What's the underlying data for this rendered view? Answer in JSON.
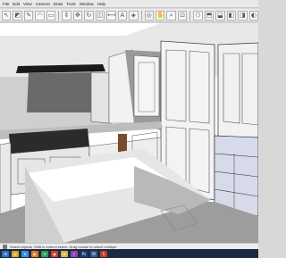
{
  "menubar": {
    "items": [
      "File",
      "Edit",
      "View",
      "Camera",
      "Draw",
      "Tools",
      "Window",
      "Help"
    ]
  },
  "toolbar": {
    "tools": [
      {
        "icon": "select-arrow-icon",
        "glyph": "↖"
      },
      {
        "icon": "eraser-icon",
        "glyph": "◩"
      },
      {
        "icon": "pencil-icon",
        "glyph": "✎"
      },
      {
        "icon": "arc-icon",
        "glyph": "◠"
      },
      {
        "icon": "rectangle-icon",
        "glyph": "▭"
      },
      {
        "icon": "push-pull-icon",
        "glyph": "⇕"
      },
      {
        "icon": "move-icon",
        "glyph": "✥"
      },
      {
        "icon": "rotate-icon",
        "glyph": "↻"
      },
      {
        "icon": "offset-icon",
        "glyph": "◫"
      },
      {
        "icon": "tape-measure-icon",
        "glyph": "⟷"
      },
      {
        "icon": "text-icon",
        "glyph": "A"
      },
      {
        "icon": "paint-bucket-icon",
        "glyph": "◈"
      },
      {
        "icon": "orbit-icon",
        "glyph": "◎"
      },
      {
        "icon": "pan-icon",
        "glyph": "✋"
      },
      {
        "icon": "zoom-icon",
        "glyph": "⌕"
      },
      {
        "icon": "zoom-extents-icon",
        "glyph": "⊡"
      },
      {
        "icon": "iso-view-icon",
        "glyph": "⬡"
      },
      {
        "icon": "top-view-icon",
        "glyph": "⬒"
      },
      {
        "icon": "front-view-icon",
        "glyph": "⬓"
      },
      {
        "icon": "right-view-icon",
        "glyph": "◧"
      },
      {
        "icon": "back-view-icon",
        "glyph": "◨"
      },
      {
        "icon": "left-view-icon",
        "glyph": "◐"
      }
    ]
  },
  "statusbar": {
    "text": "Select objects. Shift to extend select. Drag mouse to select multiple."
  },
  "taskbar": {
    "apps": [
      {
        "icon": "start-icon",
        "glyph": "⊞",
        "color": "#2f6fd0"
      },
      {
        "icon": "explorer-icon",
        "glyph": "▤",
        "color": "#d9a326"
      },
      {
        "icon": "ie-icon",
        "glyph": "e",
        "color": "#3a8ee6"
      },
      {
        "icon": "media-icon",
        "glyph": "▶",
        "color": "#e07a1f"
      },
      {
        "icon": "mail-icon",
        "glyph": "✉",
        "color": "#2d9b4f"
      },
      {
        "icon": "chrome-icon",
        "glyph": "◉",
        "color": "#d33b2c"
      },
      {
        "icon": "folder-icon",
        "glyph": "▰",
        "color": "#d6b24a"
      },
      {
        "icon": "music-icon",
        "glyph": "♪",
        "color": "#8e44ad"
      },
      {
        "icon": "photoshop-icon",
        "glyph": "Ps",
        "color": "#1f3d6b"
      },
      {
        "icon": "word-icon",
        "glyph": "W",
        "color": "#2b5797"
      },
      {
        "icon": "sketchup-icon",
        "glyph": "S",
        "color": "#c0392b"
      }
    ]
  },
  "colors": {
    "ui_bg": "#ececec",
    "viewport_bg": "#ffffff",
    "taskbar": "#1c2a40",
    "cabinet_face": "#f2f2f2",
    "shadow": "#8f8f8f",
    "dark_shadow": "#5e5e5e",
    "hood": "#1a1a1a",
    "range_top": "#2b2b2b",
    "wood_accent": "#7a4a2a",
    "blue_drawers": "#d7dbe9"
  }
}
